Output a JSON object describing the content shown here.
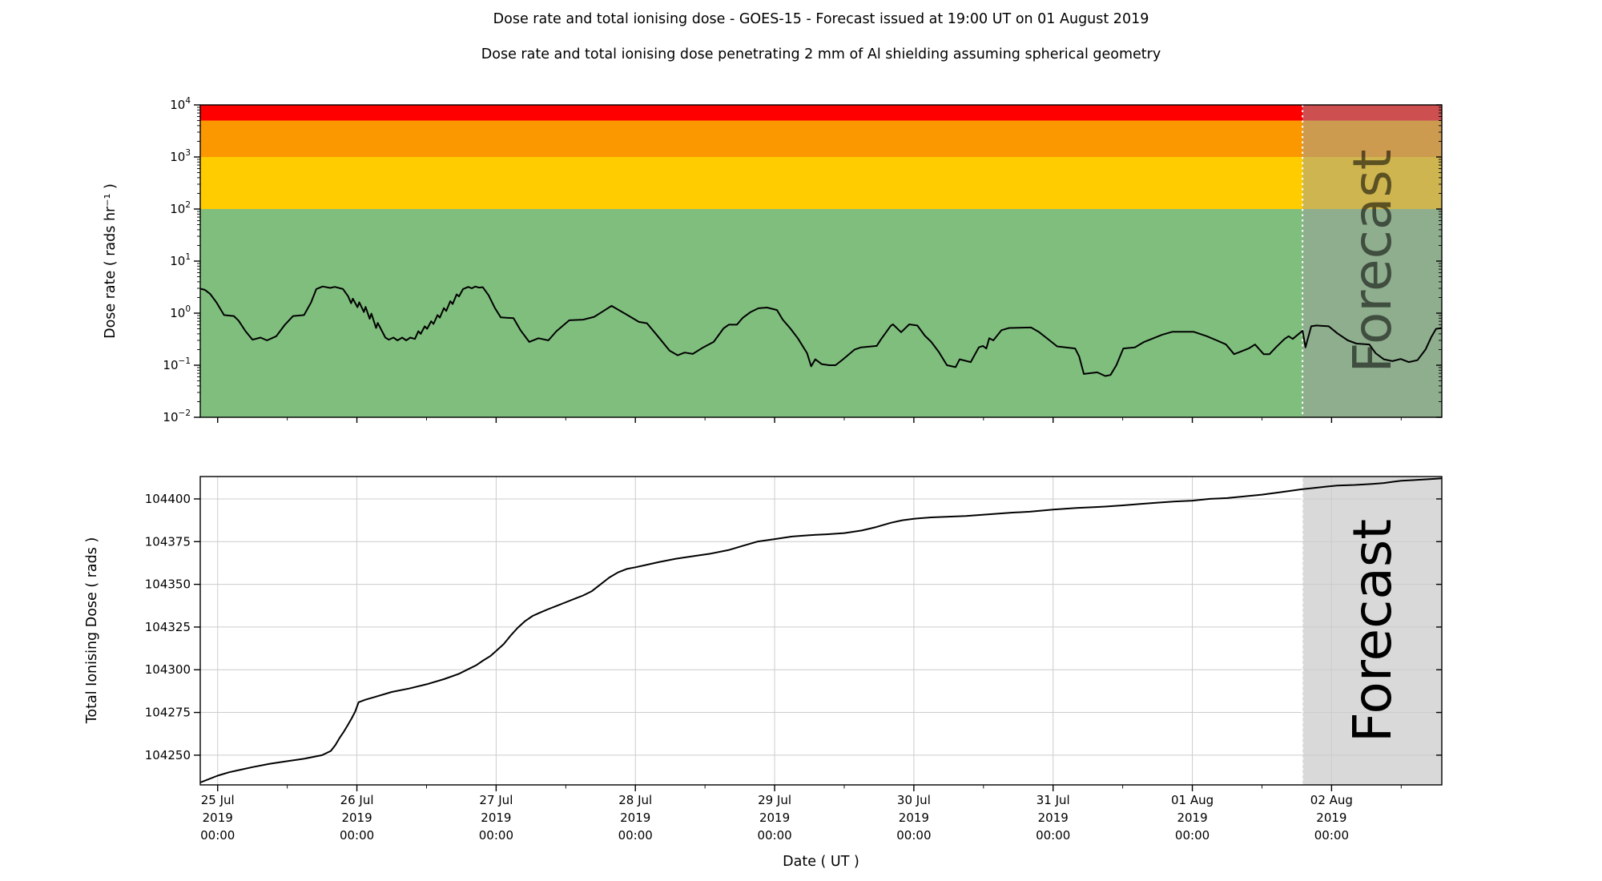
{
  "titles": {
    "main": "Dose rate and total ionising dose - GOES-15 - Forecast issued at 19:00 UT on 01 August 2019",
    "sub": "Dose rate and total ionising dose penetrating 2 mm of Al shielding assuming spherical geometry"
  },
  "x_axis": {
    "label": "Date ( UT )",
    "range_hours": [
      -3,
      211
    ],
    "minor_tick_step_hours": 12,
    "ticks": [
      {
        "hour": 0,
        "lines": [
          "25 Jul",
          "2019",
          "00:00"
        ]
      },
      {
        "hour": 24,
        "lines": [
          "26 Jul",
          "2019",
          "00:00"
        ]
      },
      {
        "hour": 48,
        "lines": [
          "27 Jul",
          "2019",
          "00:00"
        ]
      },
      {
        "hour": 72,
        "lines": [
          "28 Jul",
          "2019",
          "00:00"
        ]
      },
      {
        "hour": 96,
        "lines": [
          "29 Jul",
          "2019",
          "00:00"
        ]
      },
      {
        "hour": 120,
        "lines": [
          "30 Jul",
          "2019",
          "00:00"
        ]
      },
      {
        "hour": 144,
        "lines": [
          "31 Jul",
          "2019",
          "00:00"
        ]
      },
      {
        "hour": 168,
        "lines": [
          "01 Aug",
          "2019",
          "00:00"
        ]
      },
      {
        "hour": 192,
        "lines": [
          "02 Aug",
          "2019",
          "00:00"
        ]
      }
    ]
  },
  "forecast": {
    "label": "Forecast",
    "start_hour": 187,
    "top_overlay_color": "rgba(158,158,158,0.5)",
    "bottom_fill_color": "#d9d9d9",
    "divider_color": "#ffffff",
    "top_watermark_color": "#747474",
    "top_watermark_opacity": 0.55,
    "bottom_watermark_color": "#bdbdbd",
    "bottom_watermark_opacity": 1
  },
  "chart_data": [
    {
      "type": "line",
      "name": "dose-rate-panel",
      "ylabel": "Dose rate ( rads hr⁻¹ )",
      "y_scale": "log",
      "ylim": [
        0.01,
        10000
      ],
      "grid": false,
      "line_color": "#000000",
      "y_ticks": [
        {
          "value": 10000,
          "exp": "4"
        },
        {
          "value": 1000,
          "exp": "3"
        },
        {
          "value": 100,
          "exp": "2"
        },
        {
          "value": 10,
          "exp": "1"
        },
        {
          "value": 1,
          "exp": "0"
        },
        {
          "value": 0.1,
          "exp": "−1"
        },
        {
          "value": 0.01,
          "exp": "−2"
        }
      ],
      "bands": [
        {
          "name": "green-band",
          "from": 0.01,
          "to": 100,
          "color": "#80be7e"
        },
        {
          "name": "yellow-band",
          "from": 100,
          "to": 1000,
          "color": "#ffcc00"
        },
        {
          "name": "orange-band",
          "from": 1000,
          "to": 5000,
          "color": "#fb9800"
        },
        {
          "name": "red-band",
          "from": 5000,
          "to": 10000,
          "color": "#ff0000"
        }
      ],
      "series": [
        [
          -3,
          2.95
        ],
        [
          -2.2,
          2.8
        ],
        [
          -1.3,
          2.35
        ],
        [
          -0.2,
          1.6
        ],
        [
          1.1,
          0.92
        ],
        [
          2.8,
          0.88
        ],
        [
          3.6,
          0.72
        ],
        [
          4.8,
          0.45
        ],
        [
          6,
          0.31
        ],
        [
          7.4,
          0.34
        ],
        [
          8.5,
          0.3
        ],
        [
          10.1,
          0.36
        ],
        [
          11.6,
          0.6
        ],
        [
          13,
          0.88
        ],
        [
          14.9,
          0.92
        ],
        [
          16.1,
          1.6
        ],
        [
          17,
          2.9
        ],
        [
          18.1,
          3.25
        ],
        [
          19.4,
          3.05
        ],
        [
          20.2,
          3.2
        ],
        [
          21.6,
          2.9
        ],
        [
          22.5,
          2.1
        ],
        [
          23,
          1.55
        ],
        [
          23.3,
          1.9
        ],
        [
          24.1,
          1.3
        ],
        [
          24.4,
          1.62
        ],
        [
          25.2,
          1.05
        ],
        [
          25.5,
          1.32
        ],
        [
          26.2,
          0.78
        ],
        [
          26.5,
          0.98
        ],
        [
          27.3,
          0.52
        ],
        [
          27.6,
          0.65
        ],
        [
          28.9,
          0.34
        ],
        [
          29.5,
          0.31
        ],
        [
          30.3,
          0.34
        ],
        [
          31,
          0.3
        ],
        [
          31.8,
          0.34
        ],
        [
          32.5,
          0.3
        ],
        [
          33.2,
          0.34
        ],
        [
          34,
          0.32
        ],
        [
          34.6,
          0.45
        ],
        [
          35,
          0.4
        ],
        [
          35.7,
          0.56
        ],
        [
          36.1,
          0.5
        ],
        [
          36.8,
          0.7
        ],
        [
          37.2,
          0.62
        ],
        [
          37.9,
          0.92
        ],
        [
          38.3,
          0.82
        ],
        [
          39,
          1.25
        ],
        [
          39.4,
          1.1
        ],
        [
          40.1,
          1.7
        ],
        [
          40.5,
          1.5
        ],
        [
          41.2,
          2.3
        ],
        [
          41.6,
          2.1
        ],
        [
          42.3,
          2.9
        ],
        [
          43.2,
          3.2
        ],
        [
          43.8,
          3
        ],
        [
          44.4,
          3.25
        ],
        [
          45,
          3.1
        ],
        [
          45.7,
          3.15
        ],
        [
          46.7,
          2.2
        ],
        [
          47.8,
          1.25
        ],
        [
          48.8,
          0.83
        ],
        [
          51,
          0.8
        ],
        [
          52.2,
          0.47
        ],
        [
          53.7,
          0.28
        ],
        [
          55.3,
          0.33
        ],
        [
          57,
          0.3
        ],
        [
          58.4,
          0.45
        ],
        [
          60.6,
          0.73
        ],
        [
          63,
          0.75
        ],
        [
          64.9,
          0.85
        ],
        [
          66.5,
          1.1
        ],
        [
          67.9,
          1.38
        ],
        [
          70.4,
          0.95
        ],
        [
          72.6,
          0.68
        ],
        [
          74,
          0.64
        ],
        [
          75.7,
          0.38
        ],
        [
          77.9,
          0.19
        ],
        [
          79.3,
          0.155
        ],
        [
          80.5,
          0.175
        ],
        [
          81.9,
          0.165
        ],
        [
          83.7,
          0.22
        ],
        [
          85.5,
          0.28
        ],
        [
          87.2,
          0.51
        ],
        [
          88.1,
          0.6
        ],
        [
          89.5,
          0.6
        ],
        [
          90.5,
          0.81
        ],
        [
          91.8,
          1.04
        ],
        [
          93.2,
          1.24
        ],
        [
          94.7,
          1.28
        ],
        [
          96.4,
          1.15
        ],
        [
          97.4,
          0.75
        ],
        [
          98.7,
          0.51
        ],
        [
          100,
          0.33
        ],
        [
          101.6,
          0.17
        ],
        [
          102.3,
          0.095
        ],
        [
          103,
          0.13
        ],
        [
          104.1,
          0.105
        ],
        [
          105.4,
          0.1
        ],
        [
          106.5,
          0.1
        ],
        [
          107.8,
          0.13
        ],
        [
          109.8,
          0.2
        ],
        [
          110.9,
          0.22
        ],
        [
          113.6,
          0.235
        ],
        [
          114.3,
          0.31
        ],
        [
          116,
          0.57
        ],
        [
          116.4,
          0.61
        ],
        [
          117.8,
          0.43
        ],
        [
          119.2,
          0.61
        ],
        [
          120.6,
          0.58
        ],
        [
          121.9,
          0.37
        ],
        [
          123,
          0.28
        ],
        [
          124.3,
          0.18
        ],
        [
          125.7,
          0.1
        ],
        [
          127.2,
          0.092
        ],
        [
          127.9,
          0.13
        ],
        [
          129.8,
          0.115
        ],
        [
          131.2,
          0.22
        ],
        [
          131.9,
          0.235
        ],
        [
          132.5,
          0.21
        ],
        [
          133,
          0.33
        ],
        [
          133.7,
          0.3
        ],
        [
          135.1,
          0.47
        ],
        [
          136.4,
          0.52
        ],
        [
          140.2,
          0.53
        ],
        [
          141.5,
          0.44
        ],
        [
          143.4,
          0.3
        ],
        [
          144.7,
          0.23
        ],
        [
          147.8,
          0.21
        ],
        [
          148.5,
          0.147
        ],
        [
          149.3,
          0.068
        ],
        [
          151.6,
          0.073
        ],
        [
          153,
          0.062
        ],
        [
          153.9,
          0.065
        ],
        [
          154.9,
          0.1
        ],
        [
          156.1,
          0.21
        ],
        [
          158.1,
          0.22
        ],
        [
          159.7,
          0.28
        ],
        [
          162.8,
          0.385
        ],
        [
          164.6,
          0.44
        ],
        [
          168.2,
          0.44
        ],
        [
          170.5,
          0.36
        ],
        [
          172.2,
          0.3
        ],
        [
          173.8,
          0.25
        ],
        [
          175.2,
          0.163
        ],
        [
          176.2,
          0.18
        ],
        [
          177.7,
          0.21
        ],
        [
          178.8,
          0.25
        ],
        [
          180.3,
          0.163
        ],
        [
          181.3,
          0.163
        ],
        [
          182.4,
          0.22
        ],
        [
          183.9,
          0.32
        ],
        [
          184.6,
          0.36
        ],
        [
          185.3,
          0.32
        ],
        [
          187,
          0.46
        ],
        [
          187.5,
          0.22
        ],
        [
          188.5,
          0.56
        ],
        [
          189.4,
          0.58
        ],
        [
          191.5,
          0.56
        ],
        [
          193,
          0.41
        ],
        [
          194.8,
          0.3
        ],
        [
          196.3,
          0.26
        ],
        [
          198.5,
          0.25
        ],
        [
          199.6,
          0.17
        ],
        [
          201,
          0.13
        ],
        [
          202.5,
          0.12
        ],
        [
          203.9,
          0.132
        ],
        [
          205.3,
          0.115
        ],
        [
          206.8,
          0.125
        ],
        [
          208.2,
          0.2
        ],
        [
          209.2,
          0.35
        ],
        [
          210,
          0.5
        ],
        [
          211,
          0.52
        ]
      ]
    },
    {
      "type": "line",
      "name": "total-dose-panel",
      "ylabel": "Total Ionising Dose ( rads )",
      "y_scale": "linear",
      "ylim": [
        104232.6,
        104413.1
      ],
      "grid": true,
      "grid_color": "#cccccc",
      "line_color": "#000000",
      "y_ticks": [
        {
          "value": 104250,
          "label": "104250"
        },
        {
          "value": 104275,
          "label": "104275"
        },
        {
          "value": 104300,
          "label": "104300"
        },
        {
          "value": 104325,
          "label": "104325"
        },
        {
          "value": 104350,
          "label": "104350"
        },
        {
          "value": 104375,
          "label": "104375"
        },
        {
          "value": 104400,
          "label": "104400"
        }
      ],
      "series": [
        [
          -3,
          104234
        ],
        [
          0,
          104238
        ],
        [
          2,
          104240
        ],
        [
          4,
          104241.5
        ],
        [
          6,
          104243
        ],
        [
          9,
          104245
        ],
        [
          12,
          104246.5
        ],
        [
          15,
          104248
        ],
        [
          18,
          104250
        ],
        [
          19.5,
          104252.5
        ],
        [
          20.3,
          104256
        ],
        [
          21,
          104260
        ],
        [
          21.7,
          104263.5
        ],
        [
          22.4,
          104267.5
        ],
        [
          23.1,
          104271.5
        ],
        [
          23.7,
          104275.5
        ],
        [
          24.3,
          104281
        ],
        [
          25.5,
          104282.5
        ],
        [
          27,
          104284
        ],
        [
          30,
          104287
        ],
        [
          33,
          104289
        ],
        [
          36,
          104291.5
        ],
        [
          39,
          104294.5
        ],
        [
          41.5,
          104297.5
        ],
        [
          43,
          104300
        ],
        [
          44.5,
          104302.5
        ],
        [
          45.8,
          104305.5
        ],
        [
          47,
          104308
        ],
        [
          48,
          104311
        ],
        [
          49.3,
          104315
        ],
        [
          50.5,
          104320
        ],
        [
          51.7,
          104324.5
        ],
        [
          53,
          104328.5
        ],
        [
          54.3,
          104331.5
        ],
        [
          55.6,
          104333.5
        ],
        [
          57,
          104335.5
        ],
        [
          58.5,
          104337.5
        ],
        [
          60,
          104339.5
        ],
        [
          61.5,
          104341.5
        ],
        [
          63,
          104343.5
        ],
        [
          64.5,
          104346
        ],
        [
          66,
          104350
        ],
        [
          67.5,
          104354
        ],
        [
          69,
          104357
        ],
        [
          70.5,
          104359
        ],
        [
          72,
          104360
        ],
        [
          74,
          104361.5
        ],
        [
          76,
          104363
        ],
        [
          79,
          104365
        ],
        [
          82,
          104366.5
        ],
        [
          85,
          104368
        ],
        [
          88,
          104370
        ],
        [
          90.5,
          104372.5
        ],
        [
          93,
          104375
        ],
        [
          96,
          104376.5
        ],
        [
          99,
          104378
        ],
        [
          102,
          104378.8
        ],
        [
          105,
          104379.3
        ],
        [
          108,
          104380
        ],
        [
          111,
          104381.5
        ],
        [
          113.5,
          104383.5
        ],
        [
          116,
          104386
        ],
        [
          118,
          104387.5
        ],
        [
          120,
          104388.4
        ],
        [
          123,
          104389.2
        ],
        [
          126,
          104389.6
        ],
        [
          129,
          104390
        ],
        [
          133,
          104391
        ],
        [
          137,
          104392
        ],
        [
          140,
          104392.5
        ],
        [
          144,
          104393.8
        ],
        [
          148,
          104394.7
        ],
        [
          151,
          104395.2
        ],
        [
          153,
          104395.5
        ],
        [
          156,
          104396.2
        ],
        [
          159,
          104397
        ],
        [
          162,
          104397.8
        ],
        [
          165,
          104398.5
        ],
        [
          168,
          104399
        ],
        [
          171,
          104400
        ],
        [
          174,
          104400.5
        ],
        [
          177,
          104401.5
        ],
        [
          180,
          104402.5
        ],
        [
          183,
          104403.8
        ],
        [
          185,
          104404.8
        ],
        [
          187,
          104405.7
        ],
        [
          189,
          104406.4
        ],
        [
          191,
          104407.2
        ],
        [
          193,
          104407.8
        ],
        [
          196,
          104408.2
        ],
        [
          199,
          104408.8
        ],
        [
          201,
          104409.3
        ],
        [
          202.5,
          104410
        ],
        [
          204,
          104410.6
        ],
        [
          206,
          104411
        ],
        [
          208,
          104411.4
        ],
        [
          210,
          104411.8
        ],
        [
          211,
          104412
        ]
      ]
    }
  ]
}
